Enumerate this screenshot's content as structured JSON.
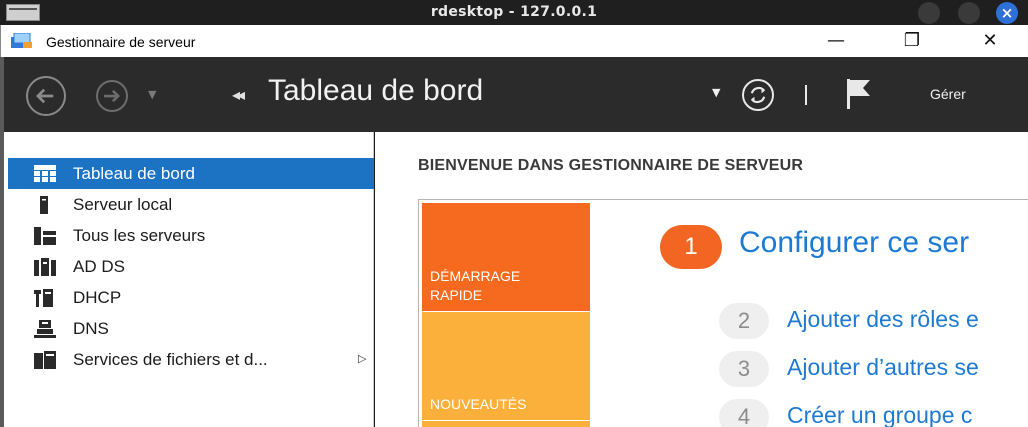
{
  "rdesktop": {
    "title": "rdesktop - 127.0.0.1"
  },
  "window": {
    "title": "Gestionnaire de serveur",
    "minimize": "—",
    "maximize": "❐",
    "close": "✕"
  },
  "nav": {
    "breadcrumb_arrow": "◂◂",
    "title": "Tableau de bord",
    "manage_label": "Gérer"
  },
  "sidebar": {
    "items": [
      {
        "label": "Tableau de bord",
        "icon": "dashboard-icon",
        "active": true
      },
      {
        "label": "Serveur local",
        "icon": "server-icon"
      },
      {
        "label": "Tous les serveurs",
        "icon": "servers-icon"
      },
      {
        "label": "AD DS",
        "icon": "adds-icon"
      },
      {
        "label": "DHCP",
        "icon": "dhcp-icon"
      },
      {
        "label": "DNS",
        "icon": "dns-icon"
      },
      {
        "label": "Services de fichiers et d...",
        "icon": "file-services-icon",
        "expandable": true
      }
    ]
  },
  "main": {
    "welcome": "BIENVENUE DANS GESTIONNAIRE DE SERVEUR",
    "tiles": {
      "quick_start": "DÉMARRAGE RAPIDE",
      "whats_new": "NOUVEAUTÉS"
    },
    "steps": [
      {
        "num": "1",
        "text": "Configurer ce ser"
      },
      {
        "num": "2",
        "text": "Ajouter des rôles e"
      },
      {
        "num": "3",
        "text": "Ajouter d’autres se"
      },
      {
        "num": "4",
        "text": "Créer un groupe c"
      }
    ]
  },
  "colors": {
    "accent": "#1c73c4",
    "quick_start_tile": "#f56a1e",
    "whats_new_tile": "#fbb03b",
    "link": "#1e7ad0",
    "header_bg": "#2b2b2b"
  }
}
